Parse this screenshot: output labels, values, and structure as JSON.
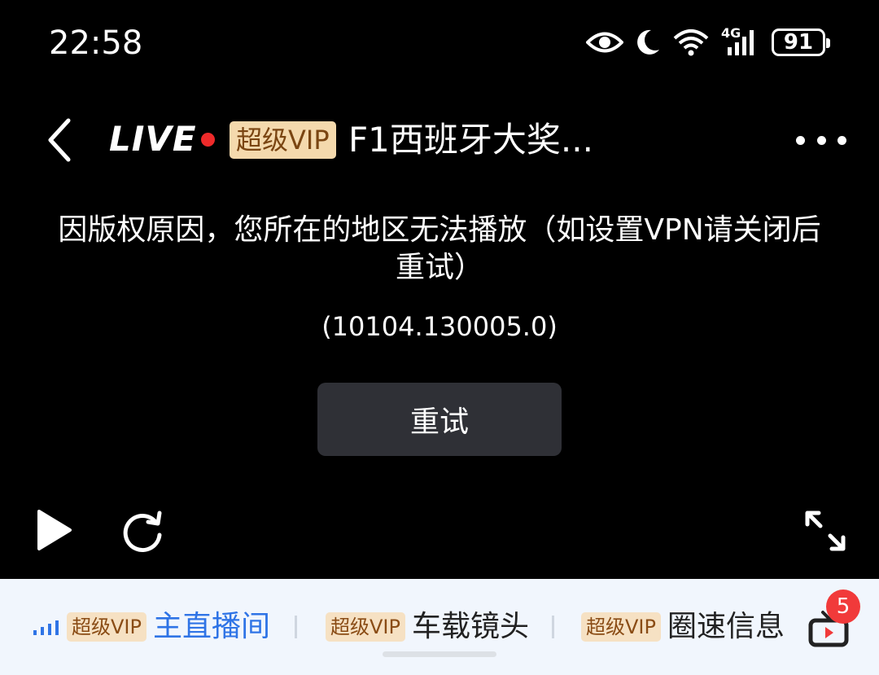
{
  "status_bar": {
    "time": "22:58",
    "network_label": "4G",
    "battery": "91",
    "icons": [
      "eye-icon",
      "moon-icon",
      "wifi-icon",
      "cellular-signal-icon",
      "battery-icon"
    ]
  },
  "header": {
    "live_label": "LIVE",
    "vip_badge": "超级VIP",
    "title": "F1西班牙大奖..."
  },
  "player": {
    "error_message": "因版权原因，您所在的地区无法播放（如设置VPN请关闭后重试）",
    "error_code": "(10104.130005.0)",
    "retry_label": "重试"
  },
  "bottom_tabs": [
    {
      "badge": "超级VIP",
      "label": "主直播间",
      "active": true
    },
    {
      "badge": "超级VIP",
      "label": "车载镜头",
      "active": false
    },
    {
      "badge": "超级VIP",
      "label": "圈速信息",
      "active": false
    }
  ],
  "tv_notification_count": "5",
  "colors": {
    "accent_blue": "#2f74e6",
    "live_red": "#ee2a2a",
    "vip_gold": "#f4d9ad",
    "badge_red": "#f13a3a"
  }
}
